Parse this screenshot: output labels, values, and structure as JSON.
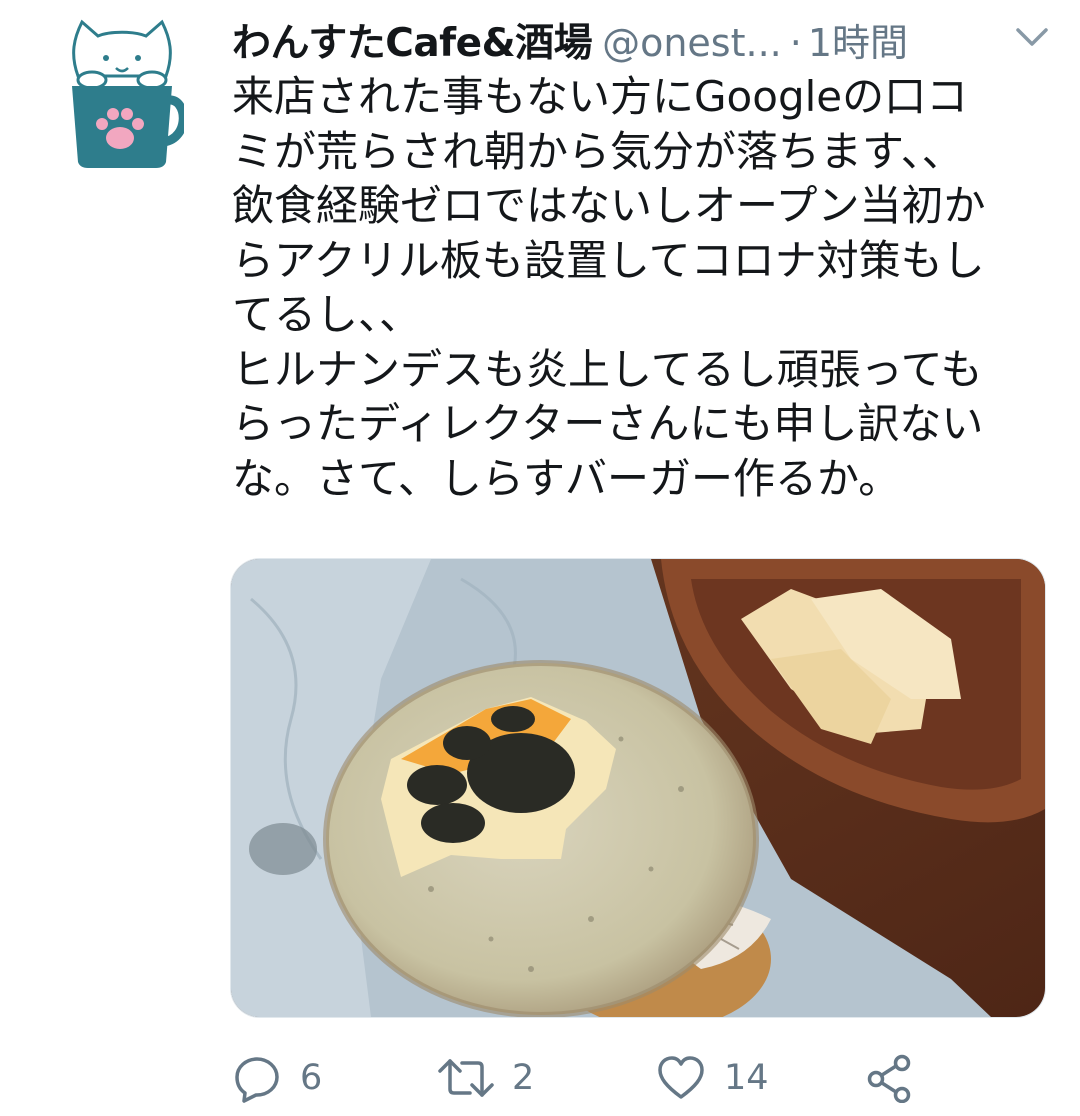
{
  "tweet": {
    "author_name": "わんすたCafe&酒場",
    "author_handle": "@onest...",
    "separator": "·",
    "time": "1時間",
    "text": "来店された事もない方にGoogleの口コ\nミが荒らされ朝から気分が落ちます、、\n飲食経験ゼロではないしオープン当初か\nらアクリル板も設置してコロナ対策もし\nてるし、、\nヒルナンデスも炎上してるし頑張っても\nらったディレクターさんにも申し訳ない\nな。さて、しらすバーガー作るか。",
    "media_description": "food-photo-shirasu-burger"
  },
  "actions": {
    "reply": {
      "icon": "reply-icon",
      "count": "6"
    },
    "retweet": {
      "icon": "retweet-icon",
      "count": "2"
    },
    "like": {
      "icon": "heart-icon",
      "count": "14"
    },
    "share": {
      "icon": "share-icon"
    }
  },
  "colors": {
    "text": "#14171a",
    "secondary": "#657786",
    "avatar_mug": "#2e7d8c",
    "avatar_paw": "#f2a7c0"
  }
}
